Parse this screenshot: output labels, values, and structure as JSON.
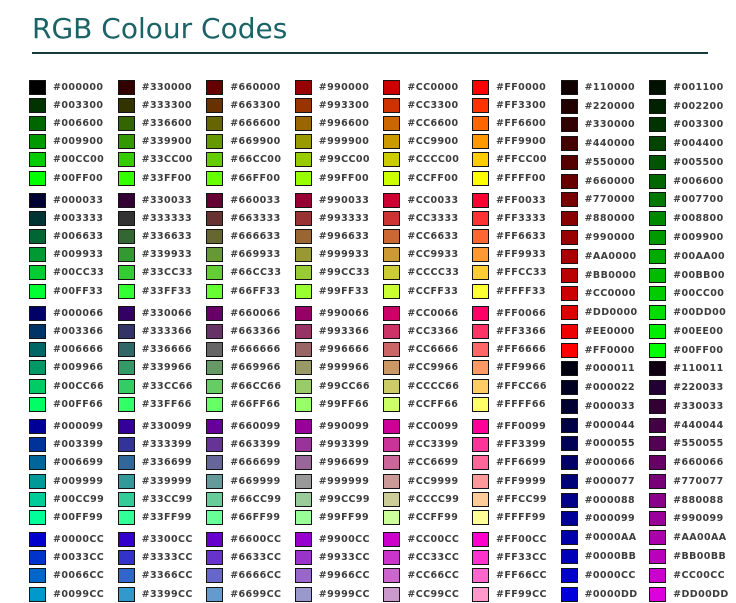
{
  "page": {
    "title": "RGB Colour Codes",
    "title_color": "#1a6366",
    "rule_color": "#173a3c",
    "background": "#ffffff",
    "label_color": "#3d3d3d",
    "swatch_border_color": "#141414"
  },
  "grid": {
    "group_size": 6,
    "columns": [
      {
        "name": "red-00",
        "grouped": true,
        "items": [
          "#000000",
          "#003300",
          "#006600",
          "#009900",
          "#00CC00",
          "#00FF00",
          "#000033",
          "#003333",
          "#006633",
          "#009933",
          "#00CC33",
          "#00FF33",
          "#000066",
          "#003366",
          "#006666",
          "#009966",
          "#00CC66",
          "#00FF66",
          "#000099",
          "#003399",
          "#006699",
          "#009999",
          "#00CC99",
          "#00FF99",
          "#0000CC",
          "#0033CC",
          "#0066CC",
          "#0099CC"
        ]
      },
      {
        "name": "red-33",
        "grouped": true,
        "items": [
          "#330000",
          "#333300",
          "#336600",
          "#339900",
          "#33CC00",
          "#33FF00",
          "#330033",
          "#333333",
          "#336633",
          "#339933",
          "#33CC33",
          "#33FF33",
          "#330066",
          "#333366",
          "#336666",
          "#339966",
          "#33CC66",
          "#33FF66",
          "#330099",
          "#333399",
          "#336699",
          "#339999",
          "#33CC99",
          "#33FF99",
          "#3300CC",
          "#3333CC",
          "#3366CC",
          "#3399CC"
        ]
      },
      {
        "name": "red-66",
        "grouped": true,
        "items": [
          "#660000",
          "#663300",
          "#666600",
          "#669900",
          "#66CC00",
          "#66FF00",
          "#660033",
          "#663333",
          "#666633",
          "#669933",
          "#66CC33",
          "#66FF33",
          "#660066",
          "#663366",
          "#666666",
          "#669966",
          "#66CC66",
          "#66FF66",
          "#660099",
          "#663399",
          "#666699",
          "#669999",
          "#66CC99",
          "#66FF99",
          "#6600CC",
          "#6633CC",
          "#6666CC",
          "#6699CC"
        ]
      },
      {
        "name": "red-99",
        "grouped": true,
        "items": [
          "#990000",
          "#993300",
          "#996600",
          "#999900",
          "#99CC00",
          "#99FF00",
          "#990033",
          "#993333",
          "#996633",
          "#999933",
          "#99CC33",
          "#99FF33",
          "#990066",
          "#993366",
          "#996666",
          "#999966",
          "#99CC66",
          "#99FF66",
          "#990099",
          "#993399",
          "#996699",
          "#999999",
          "#99CC99",
          "#99FF99",
          "#9900CC",
          "#9933CC",
          "#9966CC",
          "#9999CC"
        ]
      },
      {
        "name": "red-cc",
        "grouped": true,
        "items": [
          "#CC0000",
          "#CC3300",
          "#CC6600",
          "#CC9900",
          "#CCCC00",
          "#CCFF00",
          "#CC0033",
          "#CC3333",
          "#CC6633",
          "#CC9933",
          "#CCCC33",
          "#CCFF33",
          "#CC0066",
          "#CC3366",
          "#CC6666",
          "#CC9966",
          "#CCCC66",
          "#CCFF66",
          "#CC0099",
          "#CC3399",
          "#CC6699",
          "#CC9999",
          "#CCCC99",
          "#CCFF99",
          "#CC00CC",
          "#CC33CC",
          "#CC66CC",
          "#CC99CC"
        ]
      },
      {
        "name": "red-ff",
        "grouped": true,
        "items": [
          "#FF0000",
          "#FF3300",
          "#FF6600",
          "#FF9900",
          "#FFCC00",
          "#FFFF00",
          "#FF0033",
          "#FF3333",
          "#FF6633",
          "#FF9933",
          "#FFCC33",
          "#FFFF33",
          "#FF0066",
          "#FF3366",
          "#FF6666",
          "#FF9966",
          "#FFCC66",
          "#FFFF66",
          "#FF0099",
          "#FF3399",
          "#FF6699",
          "#FF9999",
          "#FFCC99",
          "#FFFF99",
          "#FF00CC",
          "#FF33CC",
          "#FF66CC",
          "#FF99CC"
        ]
      },
      {
        "name": "ramp-red-then-blue",
        "grouped": false,
        "items": [
          "#110000",
          "#220000",
          "#330000",
          "#440000",
          "#550000",
          "#660000",
          "#770000",
          "#880000",
          "#990000",
          "#AA0000",
          "#BB0000",
          "#CC0000",
          "#DD0000",
          "#EE0000",
          "#FF0000",
          "#000011",
          "#000022",
          "#000033",
          "#000044",
          "#000055",
          "#000066",
          "#000077",
          "#000088",
          "#000099",
          "#0000AA",
          "#0000BB",
          "#0000CC",
          "#0000DD"
        ]
      },
      {
        "name": "ramp-green-then-magenta",
        "grouped": false,
        "items": [
          "#001100",
          "#002200",
          "#003300",
          "#004400",
          "#005500",
          "#006600",
          "#007700",
          "#008800",
          "#009900",
          "#00AA00",
          "#00BB00",
          "#00CC00",
          "#00DD00",
          "#00EE00",
          "#00FF00",
          "#110011",
          "#220033",
          "#330033",
          "#440044",
          "#550055",
          "#660066",
          "#770077",
          "#880088",
          "#990099",
          "#AA00AA",
          "#BB00BB",
          "#CC00CC",
          "#DD00DD"
        ]
      }
    ]
  }
}
